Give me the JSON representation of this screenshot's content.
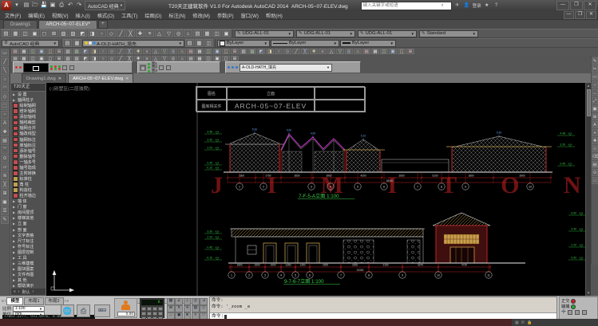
{
  "window": {
    "title": "T20天正建筑软件 V1.0 For Autodesk AutoCAD 2014",
    "doc": "ARCH-05~07-ELEV.dwg",
    "search_placeholder": "键入关键字或短语",
    "signin": "登录",
    "workspace": "AutoCAD 经典"
  },
  "qat": [
    "app-menu",
    "open",
    "save",
    "saveas",
    "plot",
    "undo",
    "redo"
  ],
  "menubar": [
    "文件(F)",
    "编辑(E)",
    "视图(V)",
    "插入(I)",
    "格式(O)",
    "工具(T)",
    "绘图(D)",
    "标注(N)",
    "修改(M)",
    "参数(P)",
    "窗口(W)",
    "帮助(H)"
  ],
  "filetabs": [
    {
      "label": "Drawing1",
      "active": false
    },
    {
      "label": "ARCH-05~07-ELEV*",
      "active": true
    }
  ],
  "tb1": {
    "icons": [
      "new",
      "open",
      "save",
      "plot",
      "plot-preview",
      "publish",
      "cut",
      "copy",
      "paste",
      "match-properties",
      "block-editor",
      "undo",
      "redo",
      "pan",
      "zoom-realtime",
      "zoom-window",
      "zoom-previous",
      "properties",
      "designcenter",
      "tool-palettes",
      "sheetset-manager",
      "markup",
      "quickcalc",
      "help"
    ],
    "styles": [
      {
        "icon": "text-style",
        "value": "UDG-ALL-01"
      },
      {
        "icon": "dim-style",
        "value": "UDG-ALL-01"
      },
      {
        "icon": "table-style",
        "value": "UDG-ALL-01"
      },
      {
        "icon": "mleader-style",
        "value": "Standard"
      }
    ]
  },
  "tb2": {
    "workspace": "AutoCAD 经典",
    "pre_icons": [
      "layer-properties",
      "layer-states"
    ],
    "layer": "A-OLD-HATH_填充",
    "post_icons": [
      "layer-make-current",
      "layer-previous",
      "layer-match"
    ],
    "color": "ByLayer",
    "linetype": "ByLayer",
    "lineweight": "ByLayer"
  },
  "rowA": [
    "axis-grid",
    "axis-add",
    "axis-trim",
    "axis-label",
    "axis-number",
    "column",
    "corner-column",
    "wall",
    "wall-edit",
    "door",
    "window",
    "corner-window",
    "bay-window",
    "opening",
    "room",
    "roof",
    "stair",
    "elevator",
    "ramp",
    "railing",
    "platform",
    "text",
    "table",
    "dim-linear",
    "dim-radial",
    "dim-angular",
    "symbol-elevation",
    "symbol-section",
    "symbol-index",
    "symbol-coord",
    "layer-control",
    "view-elevation",
    "view-section",
    "model-3d",
    "block",
    "pattern",
    "file",
    "layout",
    "export",
    "help-t20",
    "settings",
    "library",
    "demo",
    "calc-t20",
    "annotate",
    "misc"
  ],
  "rowB": [
    "erase",
    "copy",
    "mirror",
    "offset",
    "array",
    "move",
    "rotate",
    "scale",
    "stretch",
    "trim",
    "extend",
    "break",
    "chamfer",
    "fillet",
    "explode",
    "line",
    "pline",
    "circle",
    "arc",
    "rect",
    "hatch",
    "mtext",
    "table-draw",
    "point",
    "spline",
    "ellipse"
  ],
  "palettes": {
    "list": [
      "图1",
      "图2",
      "图3"
    ],
    "hatch": "A-OLD-HATH_填充"
  },
  "doctabs": [
    {
      "label": "Drawing1.dwg",
      "active": false
    },
    {
      "label": "ARCH-05~07-ELEV.dwg",
      "active": true
    }
  ],
  "t20": {
    "header": "T20天正",
    "footer_tabs": "默认",
    "items": [
      {
        "t": "g",
        "l": "设 置"
      },
      {
        "t": "g",
        "l": "轴网柱子"
      },
      {
        "t": "i",
        "l": "绘制轴网"
      },
      {
        "t": "i",
        "l": "增补轴网"
      },
      {
        "t": "i",
        "l": "添加轴线"
      },
      {
        "t": "i",
        "l": "轴线裁剪"
      },
      {
        "t": "i",
        "l": "轴网合并"
      },
      {
        "t": "i",
        "l": "轴改线型"
      },
      {
        "t": "i",
        "l": "轴网标注"
      },
      {
        "t": "i",
        "l": "单轴标注"
      },
      {
        "t": "i",
        "l": "添补轴号"
      },
      {
        "t": "i",
        "l": "删除轴号"
      },
      {
        "t": "i",
        "l": "一轴多号"
      },
      {
        "t": "i",
        "l": "轴号隐现"
      },
      {
        "t": "i",
        "l": "主附转换"
      },
      {
        "t": "i",
        "l": "标准柱"
      },
      {
        "t": "i",
        "l": "角 柱"
      },
      {
        "t": "i",
        "l": "构造柱"
      },
      {
        "t": "i",
        "l": "柱齐墙边"
      },
      {
        "t": "g",
        "l": "墙 体"
      },
      {
        "t": "g",
        "l": "门 窗"
      },
      {
        "t": "g",
        "l": "房间屋顶"
      },
      {
        "t": "g",
        "l": "楼梯其他"
      },
      {
        "t": "g",
        "l": "立 面"
      },
      {
        "t": "g",
        "l": "剖 面"
      },
      {
        "t": "g",
        "l": "文字表格"
      },
      {
        "t": "g",
        "l": "尺寸标注"
      },
      {
        "t": "g",
        "l": "符号标注"
      },
      {
        "t": "g",
        "l": "图层控制"
      },
      {
        "t": "g",
        "l": "工 具"
      },
      {
        "t": "g",
        "l": "三维建模"
      },
      {
        "t": "g",
        "l": "图块图案"
      },
      {
        "t": "g",
        "l": "文件布图"
      },
      {
        "t": "g",
        "l": "其 他"
      },
      {
        "t": "g",
        "l": "帮助演示"
      }
    ]
  },
  "drawing": {
    "corner_label": "(-)别墅区(二层独院)",
    "titleblock": {
      "r1c1": "图名",
      "r1c2": "立面",
      "r2c1": "图库相关件",
      "r2c2": "ARCH-05~07-ELEV"
    },
    "watermark": "J I M I T O N G",
    "upper": {
      "label": "7-F-5-A立面 1:100",
      "bubbles": [
        "1",
        "2",
        "3",
        "4",
        "5",
        "6",
        "7",
        "8",
        "9",
        "10"
      ],
      "dims": [
        "3300",
        "2700",
        "3600",
        "3900",
        "4200",
        "2600",
        "5100",
        "1800",
        "3900"
      ],
      "total": "28500",
      "marks_left": [
        "4.48",
        "3.30",
        "2.20",
        "0.45",
        "-0.10"
      ],
      "marks_right": [
        "4.48",
        "3.30",
        "0.45"
      ],
      "ridges": [
        "5.30",
        "5.60",
        "4.90",
        "5.10",
        "5.30"
      ]
    },
    "lower": {
      "label": "9-7-6-7立面 1:100",
      "bubbles": [
        "1",
        "2",
        "3",
        "4",
        "5",
        "6",
        "7",
        "8",
        "9",
        "10",
        "11"
      ],
      "dims": [
        "1800",
        "1500",
        "1500",
        "1350",
        "1350",
        "2925",
        "2625",
        "3150",
        "3375",
        "4725"
      ],
      "total": "24300",
      "marks_left": [
        "3.30",
        "2.20",
        "0.45",
        "-0.10"
      ],
      "marks_right": [
        "6.60",
        "4.40",
        "2.20",
        "0.00"
      ]
    },
    "colors": {
      "red": "#cc2222",
      "green": "#33cc44",
      "magenta": "#cc33cc",
      "tan": "#c8a04a",
      "cyan": "#66aaff",
      "watermark": "#7a1414"
    }
  },
  "bottom": {
    "layout_tabs": [
      "模型",
      "布局1",
      "布局2"
    ],
    "active_tab": "模型",
    "scale_label": "比例",
    "scale": "1:100",
    "unit_label": "单位",
    "unit": "mm",
    "fig_value": "0.00",
    "calc_value": "0.",
    "toggles": [
      "snap",
      "grid",
      "ortho",
      "polar",
      "osnap",
      "otrack",
      "ducs",
      "dyn",
      "lwt",
      "tpy",
      "qp",
      "sc",
      "am",
      "ap",
      "hw"
    ],
    "cmd_lines": [
      "命令:",
      "命令: '_zoom _e",
      "命令:"
    ],
    "coords": "77061.2277, 931.6976, 0.0000",
    "assist": [
      {
        "label": "正交",
        "color": "#cc2222"
      },
      {
        "label": "辅捕",
        "color": "#22aa33"
      }
    ]
  }
}
